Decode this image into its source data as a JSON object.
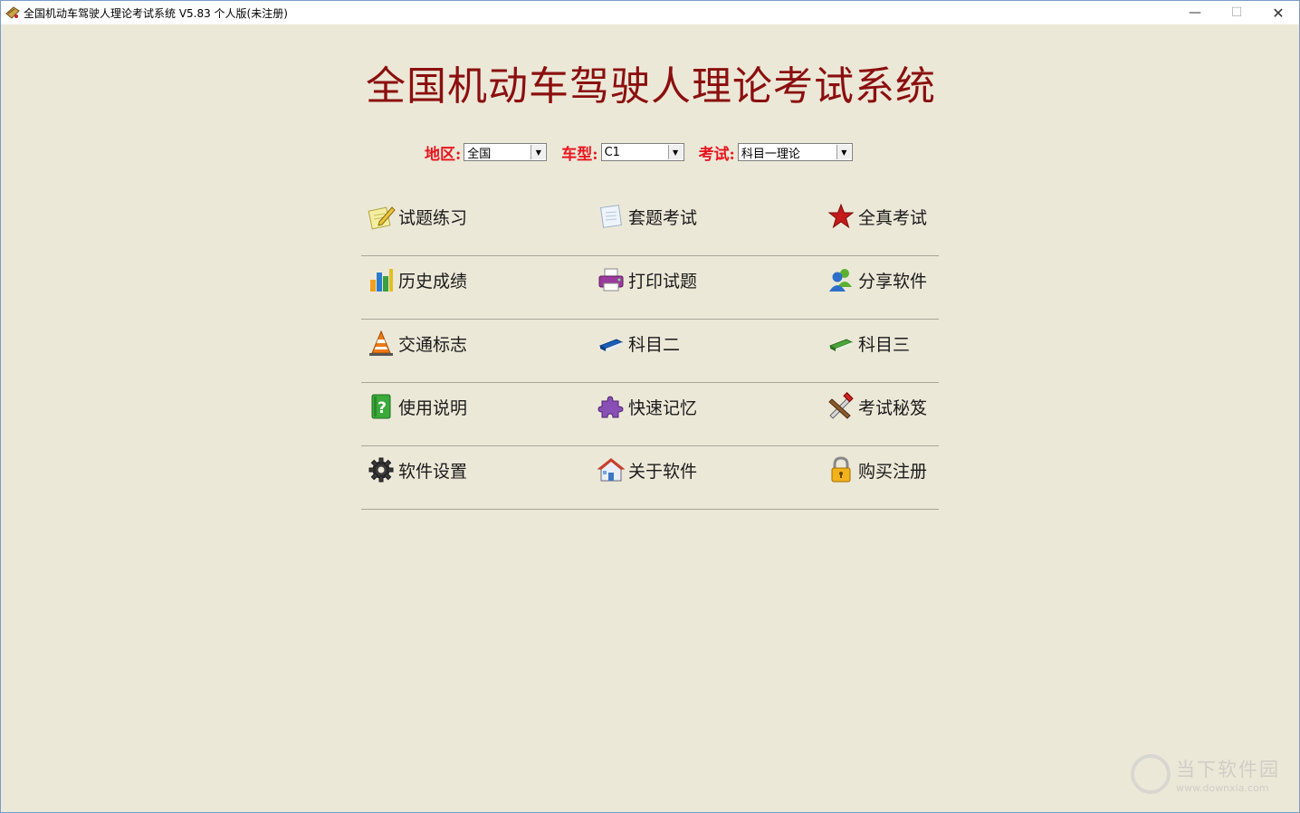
{
  "window": {
    "title": "全国机动车驾驶人理论考试系统 V5.83 个人版(未注册)",
    "min_glyph": "—",
    "max_glyph": "☐",
    "close_glyph": "✕"
  },
  "app_title": "全国机动车驾驶人理论考试系统",
  "filters": {
    "region_label": "地区:",
    "region_value": "全国",
    "vehicle_label": "车型:",
    "vehicle_value": "C1",
    "exam_label": "考试:",
    "exam_value": "科目一理论"
  },
  "menu": {
    "rows": [
      [
        {
          "label": "试题练习",
          "icon": "notepad-pencil-icon"
        },
        {
          "label": "套题考试",
          "icon": "paper-sheet-icon"
        },
        {
          "label": "全真考试",
          "icon": "star-icon"
        }
      ],
      [
        {
          "label": "历史成绩",
          "icon": "bar-chart-icon"
        },
        {
          "label": "打印试题",
          "icon": "printer-icon"
        },
        {
          "label": "分享软件",
          "icon": "users-icon"
        }
      ],
      [
        {
          "label": "交通标志",
          "icon": "traffic-cone-icon"
        },
        {
          "label": "科目二",
          "icon": "blue-eraser-icon"
        },
        {
          "label": "科目三",
          "icon": "green-eraser-icon"
        }
      ],
      [
        {
          "label": "使用说明",
          "icon": "help-book-icon"
        },
        {
          "label": "快速记忆",
          "icon": "puzzle-icon"
        },
        {
          "label": "考试秘笈",
          "icon": "tools-icon"
        }
      ],
      [
        {
          "label": "软件设置",
          "icon": "gear-icon"
        },
        {
          "label": "关于软件",
          "icon": "house-icon"
        },
        {
          "label": "购买注册",
          "icon": "lock-icon"
        }
      ]
    ]
  },
  "watermark": {
    "main": "当下软件园",
    "sub": "www.downxia.com"
  },
  "colors": {
    "background": "#ece8d8",
    "title": "#8b0f0f",
    "filter_label": "#e8141e"
  }
}
